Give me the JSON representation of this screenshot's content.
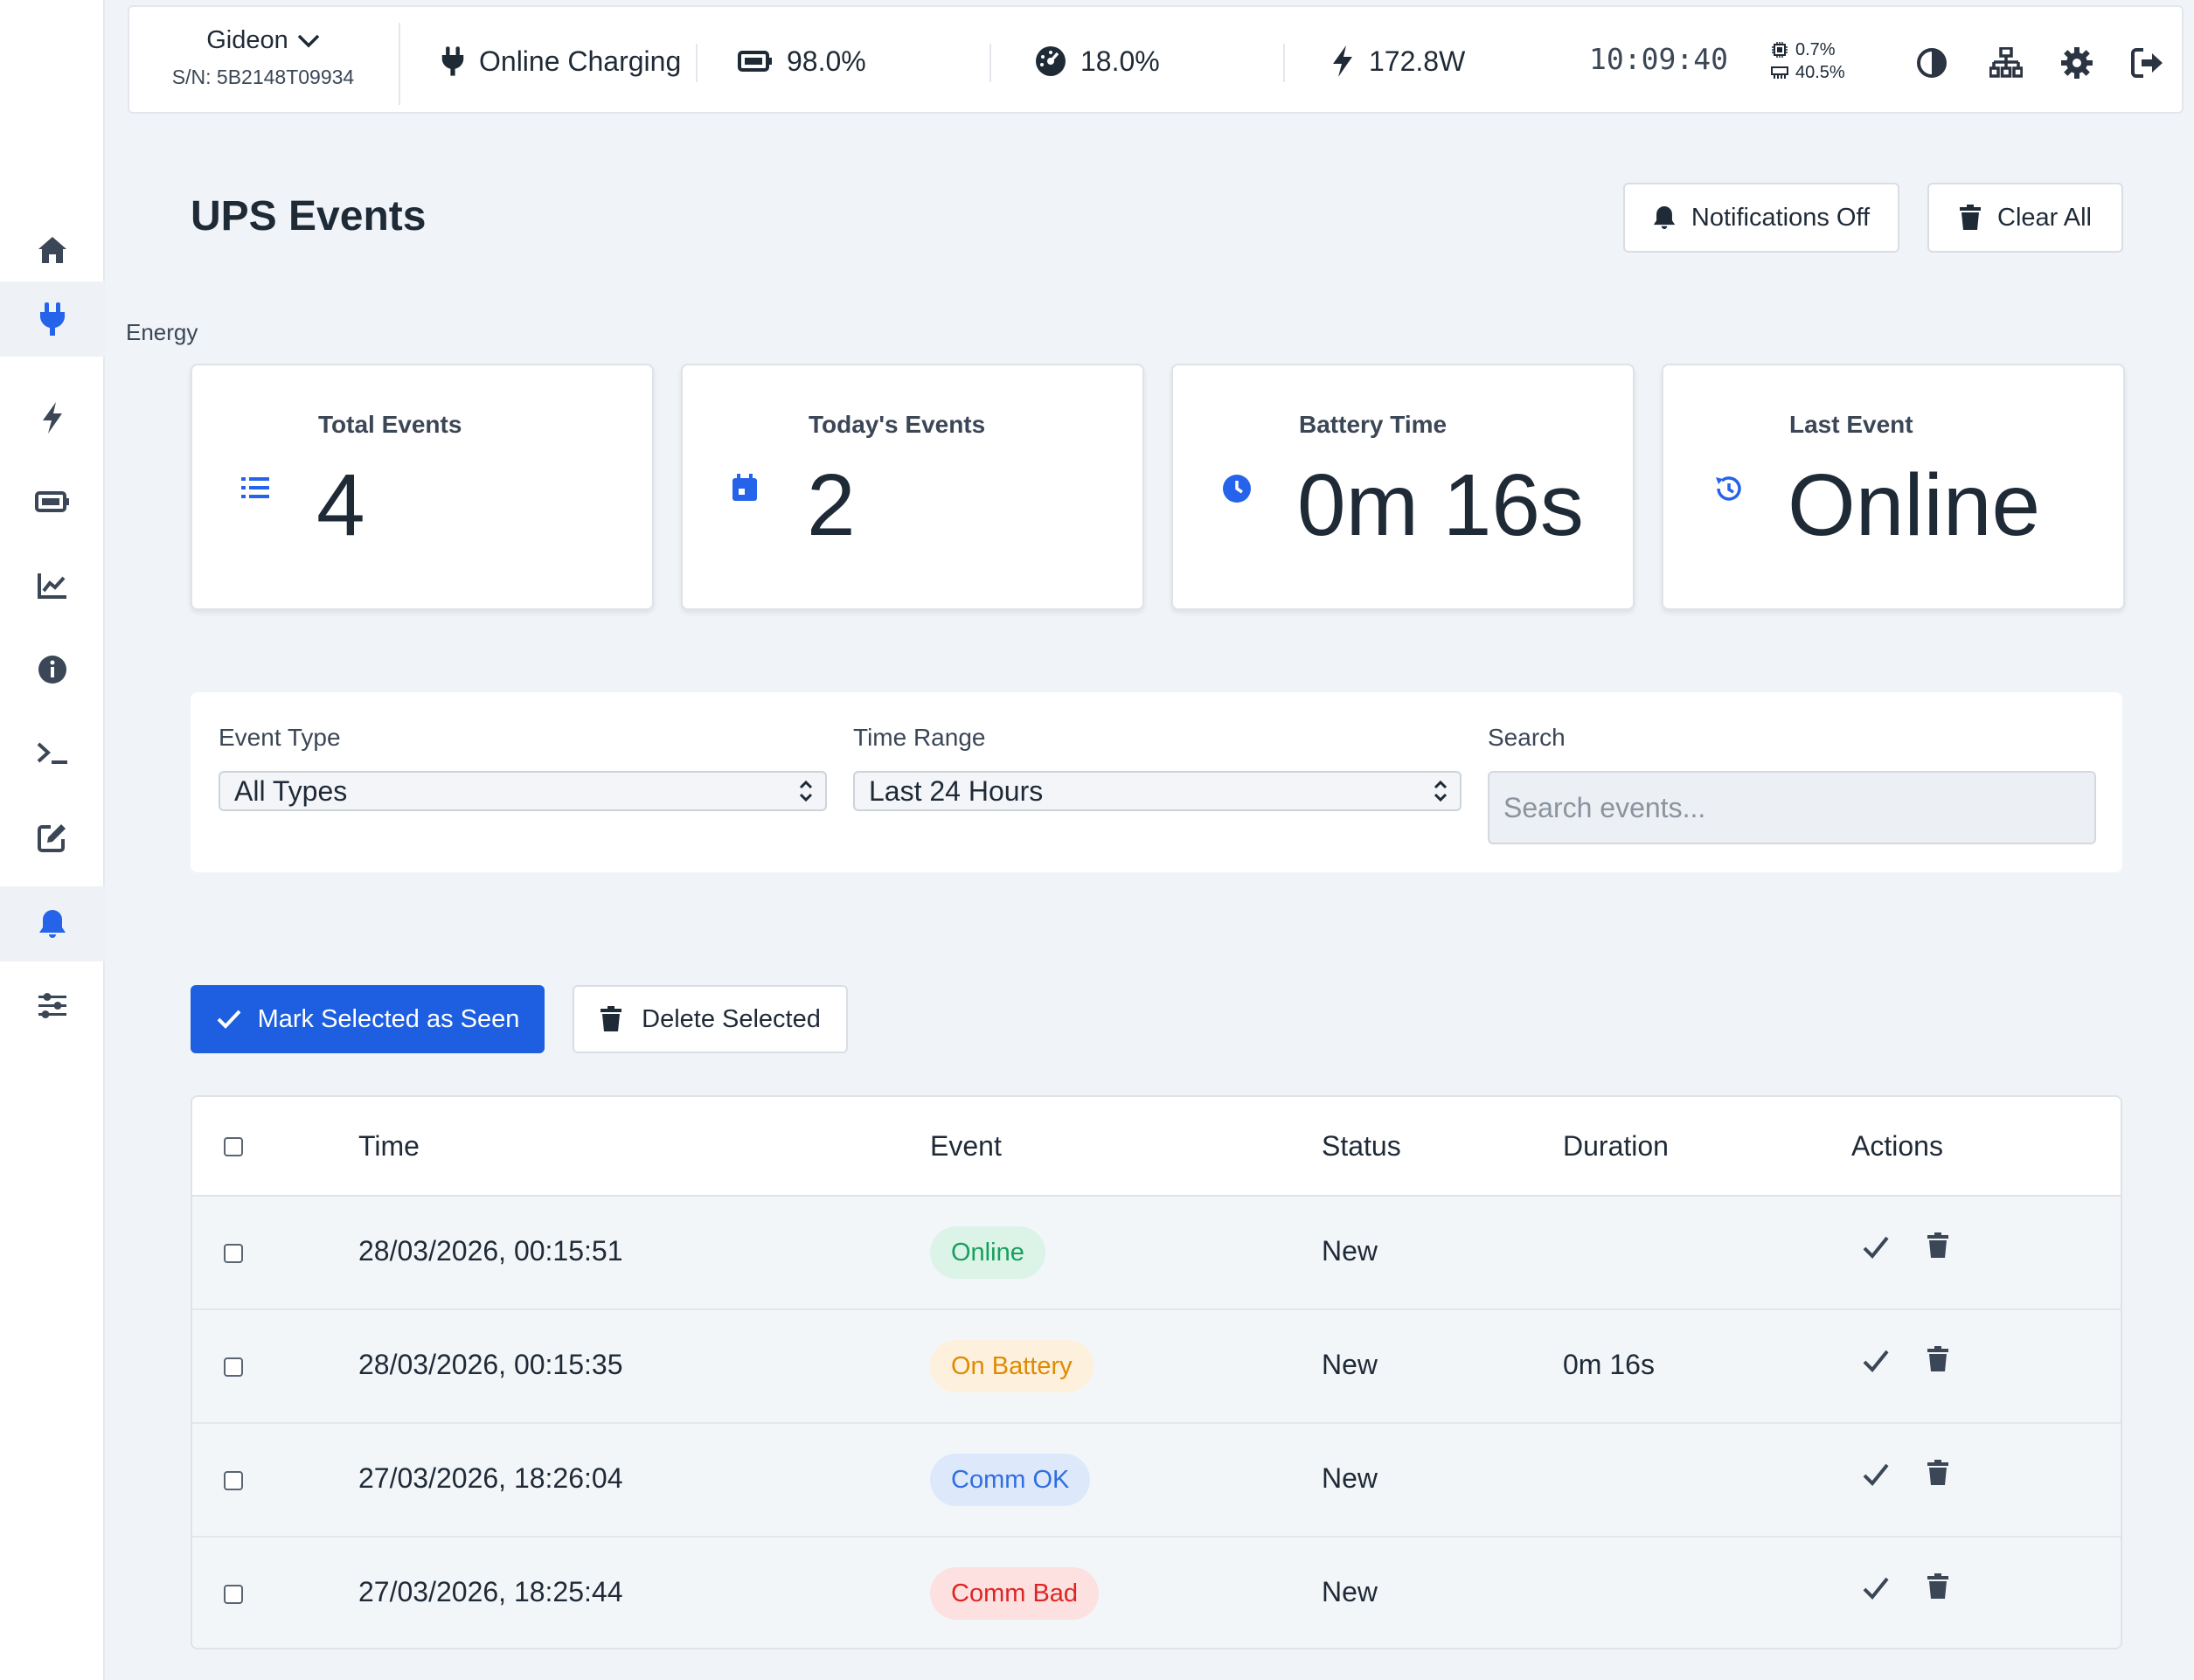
{
  "sidebar": {
    "tooltip": "Energy",
    "items": [
      {
        "icon": "home-icon"
      },
      {
        "icon": "plug-icon"
      },
      {
        "icon": "bolt-icon"
      },
      {
        "icon": "battery-icon"
      },
      {
        "icon": "chart-line-icon"
      },
      {
        "icon": "info-icon"
      },
      {
        "icon": "terminal-icon"
      },
      {
        "icon": "edit-icon"
      },
      {
        "icon": "bell-icon"
      },
      {
        "icon": "sliders-icon"
      }
    ]
  },
  "topbar": {
    "device_name": "Gideon",
    "serial": "S/N: 5B2148T09934",
    "status": "Online Charging",
    "battery": "98.0%",
    "load": "18.0%",
    "power": "172.8W",
    "clock": "10:09:40",
    "cpu": "0.7%",
    "memory": "40.5%"
  },
  "header": {
    "title": "UPS Events",
    "notifications_label": "Notifications Off",
    "clear_label": "Clear All"
  },
  "stats": {
    "total_label": "Total Events",
    "total_value": "4",
    "today_label": "Today's Events",
    "today_value": "2",
    "battery_label": "Battery Time",
    "battery_value": "0m 16s",
    "last_label": "Last Event",
    "last_value": "Online"
  },
  "filters": {
    "type_label": "Event Type",
    "type_value": "All Types",
    "range_label": "Time Range",
    "range_value": "Last 24 Hours",
    "search_label": "Search",
    "search_placeholder": "Search events..."
  },
  "actions": {
    "mark_seen_label": "Mark Selected as Seen",
    "delete_label": "Delete Selected"
  },
  "table": {
    "headers": {
      "time": "Time",
      "event": "Event",
      "status": "Status",
      "duration": "Duration",
      "actions": "Actions"
    },
    "rows": [
      {
        "time": "28/03/2026, 00:15:51",
        "event": "Online",
        "status": "New",
        "duration": ""
      },
      {
        "time": "28/03/2026, 00:15:35",
        "event": "On Battery",
        "status": "New",
        "duration": "0m 16s"
      },
      {
        "time": "27/03/2026, 18:26:04",
        "event": "Comm OK",
        "status": "New",
        "duration": ""
      },
      {
        "time": "27/03/2026, 18:25:44",
        "event": "Comm Bad",
        "status": "New",
        "duration": ""
      }
    ]
  },
  "colors": {
    "accent": "#1d5fe0",
    "online_bg": "#dcf3e8",
    "online_fg": "#16a05d",
    "battery_bg": "#fdf0dc",
    "battery_fg": "#e08a00",
    "commok_bg": "#dde8fb",
    "commok_fg": "#2f6fe0",
    "commbad_bg": "#fde0e0",
    "commbad_fg": "#dc2626"
  }
}
